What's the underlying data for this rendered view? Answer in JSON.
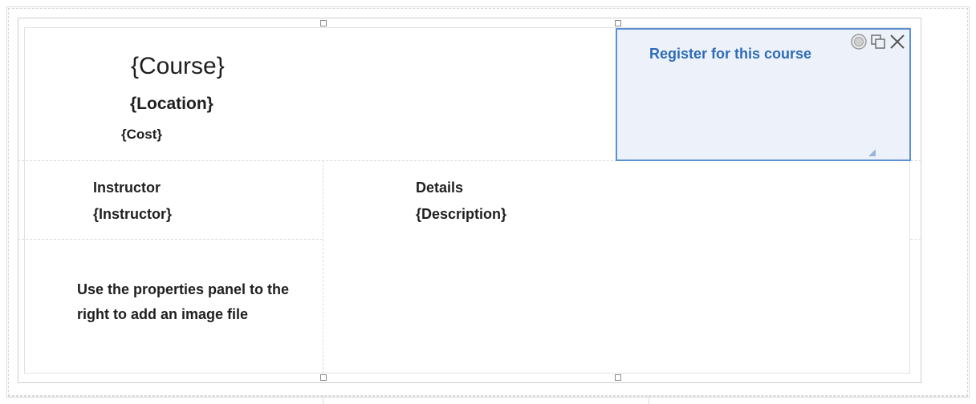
{
  "template": {
    "course_placeholder": "{Course}",
    "location_placeholder": "{Location}",
    "cost_placeholder": "{Cost}",
    "instructor_label": "Instructor",
    "instructor_placeholder": "{Instructor}",
    "details_label": "Details",
    "description_placeholder": "{Description}",
    "image_hint": "Use the properties panel to the right to add an image file"
  },
  "register_widget": {
    "link_text": "Register for this course",
    "tools": [
      "settings-icon",
      "duplicate-icon",
      "close-icon"
    ],
    "accent_color": "#2f6cb8",
    "background_color": "#edf2fa",
    "border_color": "#5b8fd6"
  }
}
